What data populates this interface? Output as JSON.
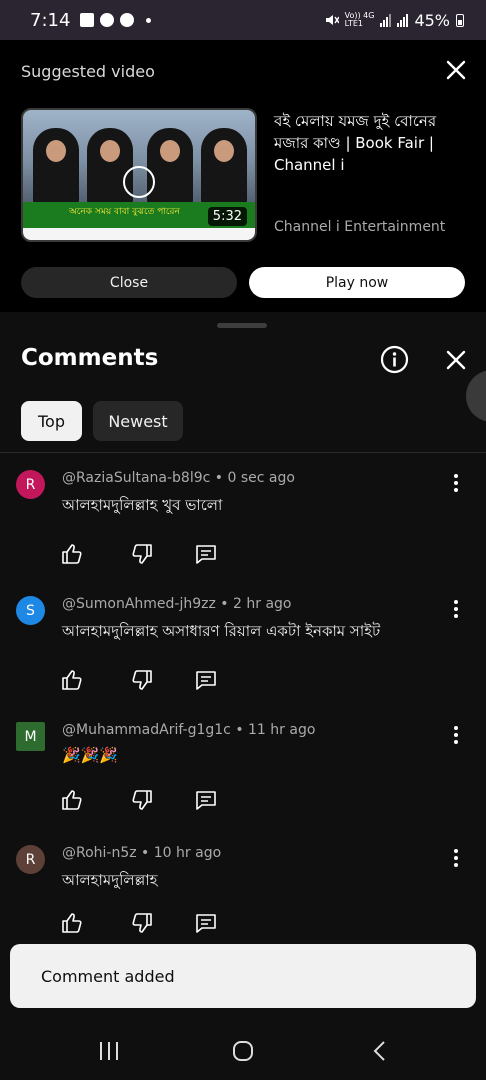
{
  "status_bar": {
    "time": "7:14",
    "network_top": "Vo)) 4G",
    "network_bottom": "LTE1",
    "battery": "45%"
  },
  "suggested": {
    "heading": "Suggested video",
    "video_title": "বই মেলায় যমজ দুই বোনের মজার কাণ্ড | Book Fair | Channel i",
    "channel": "Channel i Entertainment",
    "duration": "5:32",
    "thumbnail_caption": "অনেক সময় বাবা বুঝতে পারেন",
    "close_label": "Close",
    "play_label": "Play now"
  },
  "comments": {
    "title": "Comments",
    "filters": [
      "Top",
      "Newest"
    ],
    "items": [
      {
        "avatar_letter": "R",
        "avatar_color": "#c2185b",
        "meta": "@RaziaSultana-b8l9c • 0 sec ago",
        "text": "আলহামদুলিল্লাহ খুব ভালো"
      },
      {
        "avatar_letter": "S",
        "avatar_color": "#1e88e5",
        "meta": "@SumonAhmed-jh9zz • 2 hr ago",
        "text": "আলহামদুলিল্লাহ অসাধারণ রিয়াল একটা ইনকাম সাইট"
      },
      {
        "avatar_letter": "M",
        "avatar_color": "#2e6b2e",
        "meta": "@MuhammadArif-g1g1c • 11 hr ago",
        "text": "🎉🎉🎉"
      },
      {
        "avatar_letter": "R",
        "avatar_color": "#5d4037",
        "meta": "@Rohi-n5z • 10 hr ago",
        "text": "আলহামদুলিল্লাহ"
      }
    ]
  },
  "snackbar": {
    "message": "Comment added"
  },
  "icons": {
    "like": "thumb-up-icon",
    "dislike": "thumb-down-icon",
    "reply": "reply-icon",
    "more": "more-vert-icon"
  }
}
